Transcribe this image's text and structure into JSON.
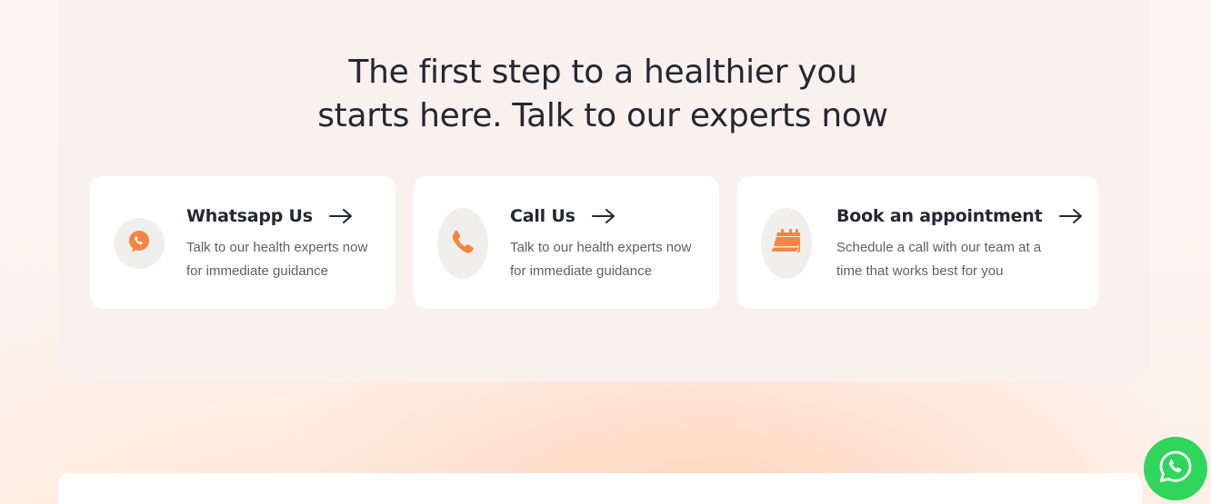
{
  "hero": {
    "headline_line1": "The first step to a healthier you",
    "headline_line2": "starts here. Talk to our experts now"
  },
  "cards": [
    {
      "title": "Whatsapp Us",
      "description": "Talk to our health experts now for immediate guidance",
      "icon": "whatsapp-icon"
    },
    {
      "title": "Call Us",
      "description": "Talk to our health experts now for immediate guidance",
      "icon": "phone-icon"
    },
    {
      "title": "Book an appointment",
      "description": "Schedule a call with our team at a time that works best for you",
      "icon": "calendar-icon"
    }
  ],
  "floating_button": {
    "icon": "whatsapp-icon"
  },
  "colors": {
    "accent": "#f7843f",
    "text_dark": "#252733",
    "text_muted": "#5f6068",
    "whatsapp_green": "#2fd65b",
    "panel_bg": "#f8f1ee"
  }
}
